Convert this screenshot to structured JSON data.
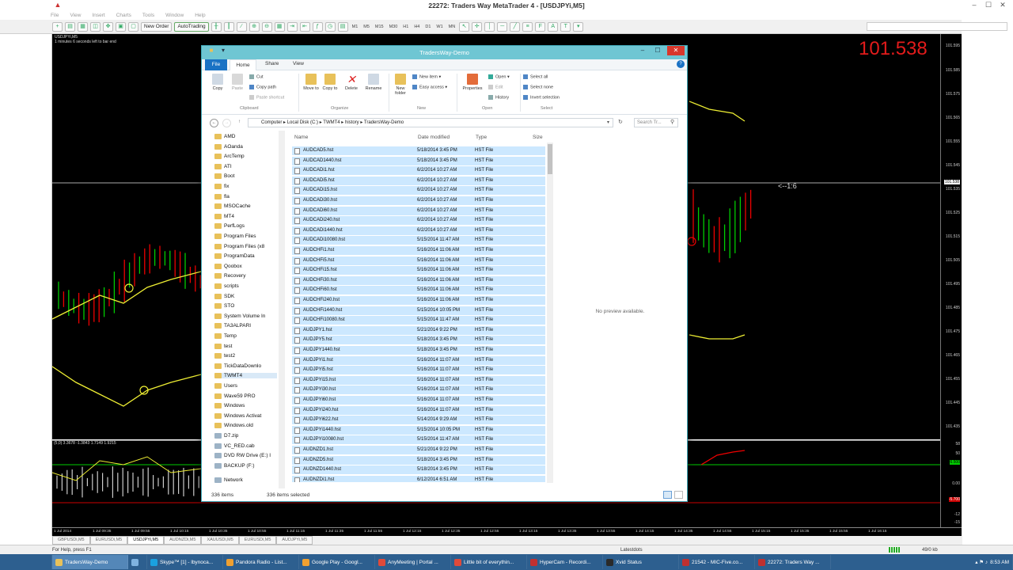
{
  "window": {
    "title": "22272: Traders Way MetaTrader 4 - [USDJPYi,M5]",
    "menu": [
      "File",
      "View",
      "Insert",
      "Charts",
      "Tools",
      "Window",
      "Help"
    ]
  },
  "toolbar": {
    "new_order": "New Order",
    "autotrading": "AutoTrading",
    "timeframes": [
      "M1",
      "M5",
      "M15",
      "M30",
      "H1",
      "H4",
      "D1",
      "W1",
      "MN"
    ]
  },
  "chart": {
    "symbol_label": "USDJPYi,M5",
    "info_line": "1 minutes 6 seconds left to bar end",
    "big_price": "101.538",
    "ratio": "<--1:6",
    "price_labels": [
      "101.595",
      "101.585",
      "101.575",
      "101.565",
      "101.555",
      "101.545",
      "101.538",
      "101.535",
      "101.525",
      "101.515",
      "101.505",
      "101.495",
      "101.485",
      "101.475",
      "101.465",
      "101.455",
      "101.445",
      "101.435"
    ],
    "sub_info": "(5,0) 3.3678 -1.3843 1.7149 1.9215",
    "sub_labels": [
      "58",
      "50",
      "6.500",
      "0.00",
      "-5.700",
      "-12",
      "-15"
    ],
    "time_labels": [
      "1 Jul 2014",
      "1 Jul 09:35",
      "1 Jul 09:55",
      "1 Jul 10:15",
      "1 Jul 10:35",
      "1 Jul 10:55",
      "1 Jul 11:15",
      "1 Jul 11:35",
      "1 Jul 11:55",
      "1 Jul 12:15",
      "1 Jul 12:35",
      "1 Jul 12:55",
      "1 Jul 13:15",
      "1 Jul 13:35",
      "1 Jul 13:55",
      "1 Jul 14:15",
      "1 Jul 14:35",
      "1 Jul 14:55",
      "1 Jul 15:15",
      "1 Jul 15:35",
      "1 Jul 15:55",
      "1 Jul 16:15"
    ]
  },
  "symbol_tabs": [
    "GBPUSDi,M5",
    "EURUSDi,M5",
    "USDJPYi,M5",
    "AUDNZDi,M5",
    "XAUUSDi,M5",
    "EURUSDi,M5",
    "AUDJPYi,M5"
  ],
  "active_symbol_tab": 2,
  "status": {
    "help": "For Help, press F1",
    "profile": "Latestdots",
    "traffic": "49/0 kb"
  },
  "explorer": {
    "title": "TradersWay-Demo",
    "tabs": [
      "File",
      "Home",
      "Share",
      "View"
    ],
    "ribbon": {
      "copy": "Copy",
      "paste": "Paste",
      "cut": "Cut",
      "copy_path": "Copy path",
      "paste_shortcut": "Paste shortcut",
      "move_to": "Move to",
      "copy_to": "Copy to",
      "delete": "Delete",
      "rename": "Rename",
      "new_folder": "New folder",
      "new_item": "New item",
      "easy_access": "Easy access",
      "properties": "Properties",
      "open": "Open",
      "edit": "Edit",
      "history": "History",
      "select_all": "Select all",
      "select_none": "Select none",
      "invert_selection": "Invert selection",
      "groups": [
        "Clipboard",
        "Organize",
        "New",
        "Open",
        "Select"
      ]
    },
    "breadcrumb": [
      "Computer",
      "Local Disk (C:)",
      "TWMT4",
      "history",
      "TradersWay-Demo"
    ],
    "search_placeholder": "Search Tr...",
    "nav_items": [
      "AMD",
      "AOanda",
      "ArcTemp",
      "ATI",
      "Boot",
      "fix",
      "fla",
      "MSOCache",
      "MT4",
      "PerfLogs",
      "Program Files",
      "Program Files (x8",
      "ProgramData",
      "Qoobox",
      "Recovery",
      "scripts",
      "SDK",
      "STO",
      "System Volume In",
      "TA3ALPARI",
      "Temp",
      "test",
      "test2",
      "TickDataDownlo",
      "TWMT4",
      "Users",
      "Wave59 PRO",
      "Windows",
      "Windows Activat",
      "Windows.old",
      "D7.zip",
      "VC_RED.cab",
      "DVD RW Drive (E:) I",
      "BACKUP (F:)",
      "Network"
    ],
    "nav_selected": 24,
    "columns": [
      "Name",
      "Date modified",
      "Type",
      "Size"
    ],
    "files": [
      [
        "AUDCAD5.hst",
        "5/18/2014 3:45 PM",
        "HST File"
      ],
      [
        "AUDCAD1440.hst",
        "5/18/2014 3:45 PM",
        "HST File"
      ],
      [
        "AUDCADi1.hst",
        "6/2/2014 10:27 AM",
        "HST File"
      ],
      [
        "AUDCADi5.hst",
        "6/2/2014 10:27 AM",
        "HST File"
      ],
      [
        "AUDCADi15.hst",
        "6/2/2014 10:27 AM",
        "HST File"
      ],
      [
        "AUDCADi30.hst",
        "6/2/2014 10:27 AM",
        "HST File"
      ],
      [
        "AUDCADi60.hst",
        "6/2/2014 10:27 AM",
        "HST File"
      ],
      [
        "AUDCADi240.hst",
        "6/2/2014 10:27 AM",
        "HST File"
      ],
      [
        "AUDCADi1440.hst",
        "6/2/2014 10:27 AM",
        "HST File"
      ],
      [
        "AUDCADi10080.hst",
        "5/15/2014 11:47 AM",
        "HST File"
      ],
      [
        "AUDCHFi1.hst",
        "5/16/2014 11:06 AM",
        "HST File"
      ],
      [
        "AUDCHFi5.hst",
        "5/16/2014 11:06 AM",
        "HST File"
      ],
      [
        "AUDCHFi15.hst",
        "5/16/2014 11:06 AM",
        "HST File"
      ],
      [
        "AUDCHFi30.hst",
        "5/16/2014 11:06 AM",
        "HST File"
      ],
      [
        "AUDCHFi60.hst",
        "5/16/2014 11:06 AM",
        "HST File"
      ],
      [
        "AUDCHFi240.hst",
        "5/16/2014 11:06 AM",
        "HST File"
      ],
      [
        "AUDCHFi1440.hst",
        "5/15/2014 10:05 PM",
        "HST File"
      ],
      [
        "AUDCHFi10080.hst",
        "5/15/2014 11:47 AM",
        "HST File"
      ],
      [
        "AUDJPY1.hst",
        "5/21/2014 9:22 PM",
        "HST File"
      ],
      [
        "AUDJPY5.hst",
        "5/18/2014 3:45 PM",
        "HST File"
      ],
      [
        "AUDJPY1440.hst",
        "5/18/2014 3:45 PM",
        "HST File"
      ],
      [
        "AUDJPYi1.hst",
        "5/16/2014 11:07 AM",
        "HST File"
      ],
      [
        "AUDJPYi5.hst",
        "5/16/2014 11:07 AM",
        "HST File"
      ],
      [
        "AUDJPYi15.hst",
        "5/16/2014 11:07 AM",
        "HST File"
      ],
      [
        "AUDJPYi30.hst",
        "5/16/2014 11:07 AM",
        "HST File"
      ],
      [
        "AUDJPYi60.hst",
        "5/16/2014 11:07 AM",
        "HST File"
      ],
      [
        "AUDJPYi240.hst",
        "5/16/2014 11:07 AM",
        "HST File"
      ],
      [
        "AUDJPYi622.hst",
        "5/14/2014 9:29 AM",
        "HST File"
      ],
      [
        "AUDJPYi1440.hst",
        "5/15/2014 10:05 PM",
        "HST File"
      ],
      [
        "AUDJPYi10080.hst",
        "5/15/2014 11:47 AM",
        "HST File"
      ],
      [
        "AUDNZD1.hst",
        "5/21/2014 9:22 PM",
        "HST File"
      ],
      [
        "AUDNZD5.hst",
        "5/18/2014 3:45 PM",
        "HST File"
      ],
      [
        "AUDNZD1440.hst",
        "5/18/2014 3:45 PM",
        "HST File"
      ],
      [
        "AUDNZDi1.hst",
        "6/12/2014 6:51 AM",
        "HST File"
      ]
    ],
    "preview_text": "No preview available.",
    "item_count": "336 items",
    "selected_count": "336 items selected"
  },
  "taskbar": [
    {
      "label": "TradersWay-Demo",
      "color": "#e8c15a",
      "active": true
    },
    {
      "label": "",
      "color": "#7fb3e0",
      "active": false
    },
    {
      "label": "Skype™ [1] - lbynoca...",
      "color": "#1aa1e0",
      "active": false
    },
    {
      "label": "Pandora Radio - List...",
      "color": "#f0a030",
      "active": false
    },
    {
      "label": "Google Play - Googl...",
      "color": "#f0a030",
      "active": false
    },
    {
      "label": "AnyMeeting | Portal ...",
      "color": "#e04a3a",
      "active": false
    },
    {
      "label": "Little bit of everythin...",
      "color": "#e04a3a",
      "active": false
    },
    {
      "label": "HyperCam - Recordi...",
      "color": "#c03030",
      "active": false
    },
    {
      "label": "Xvid Status",
      "color": "#2a2a2a",
      "active": false
    },
    {
      "label": "21542 - MIC-Five.co...",
      "color": "#c03030",
      "active": false
    },
    {
      "label": "22272: Traders Way ...",
      "color": "#c03030",
      "active": false
    }
  ],
  "clock": "8:53 AM"
}
